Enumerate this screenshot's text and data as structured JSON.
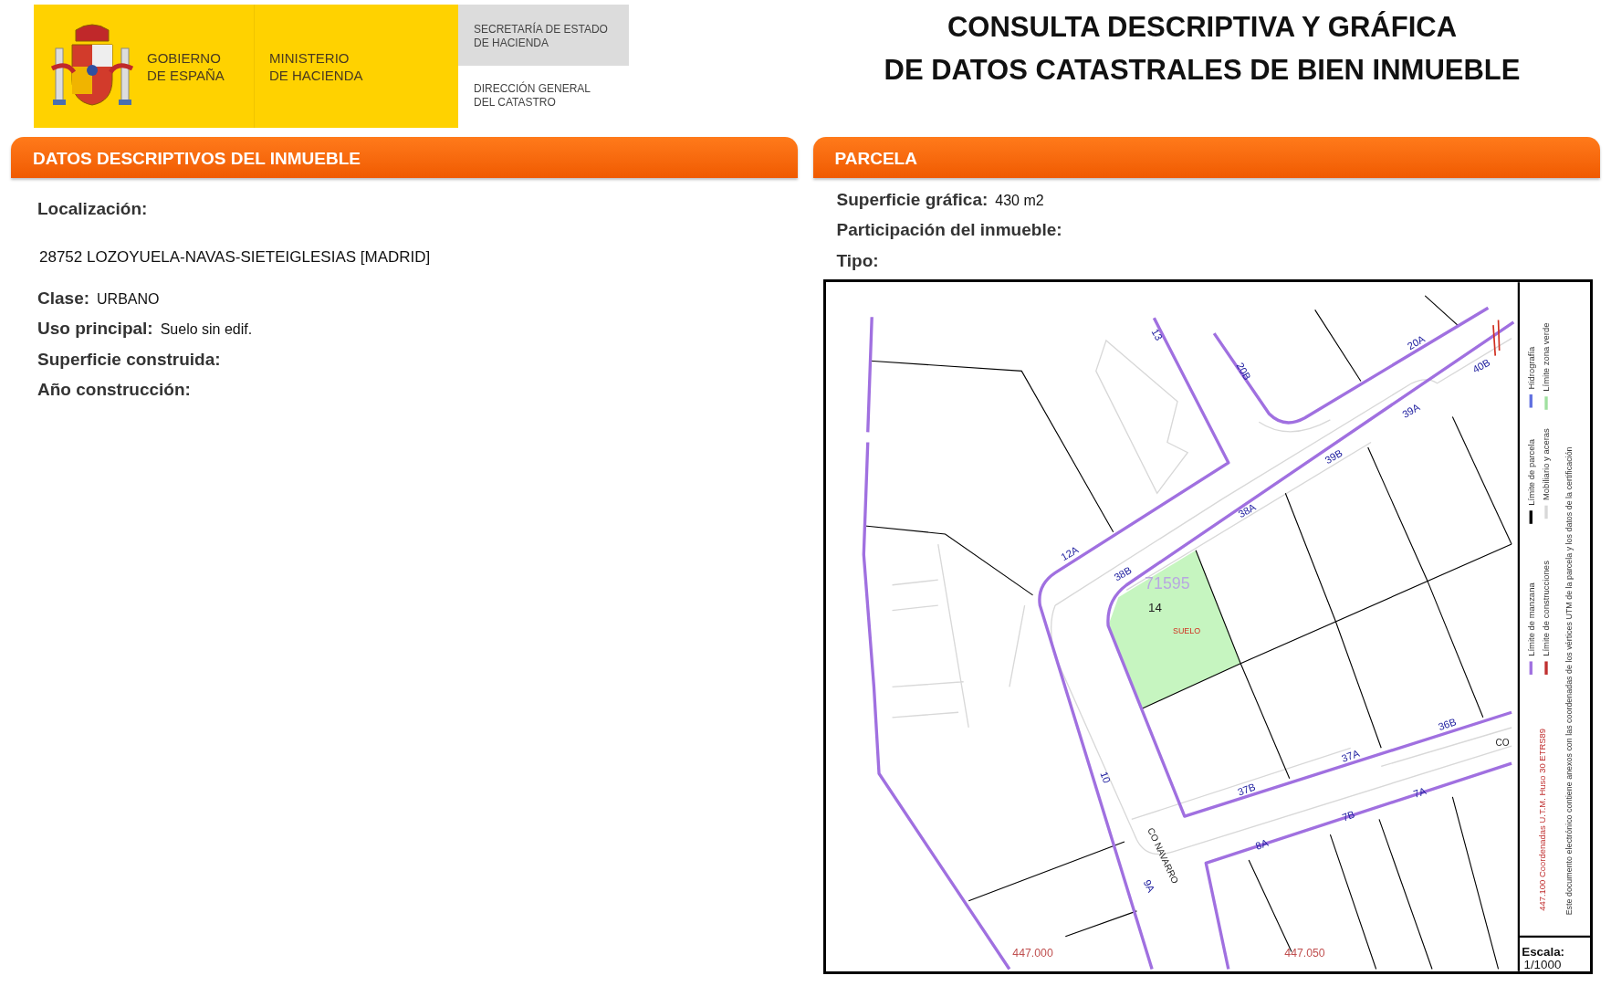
{
  "header": {
    "logo": {
      "government": [
        "GOBIERNO",
        "DE ESPAÑA"
      ],
      "ministry": [
        "MINISTERIO",
        "DE HACIENDA"
      ],
      "secretariat": [
        "SECRETARÍA DE ESTADO",
        "DE HACIENDA"
      ],
      "directorate": [
        "DIRECCIÓN GENERAL",
        "DEL CATASTRO"
      ]
    },
    "title": [
      "CONSULTA DESCRIPTIVA Y GRÁFICA",
      "DE DATOS CATASTRALES DE BIEN INMUEBLE"
    ]
  },
  "descriptive": {
    "title": "DATOS DESCRIPTIVOS DEL INMUEBLE",
    "location_label": "Localización:",
    "address": "28752 LOZOYUELA-NAVAS-SIETEIGLESIAS [MADRID]",
    "fields": [
      {
        "label": "Clase:",
        "value": "URBANO"
      },
      {
        "label": "Uso principal:",
        "value": "Suelo sin edif."
      },
      {
        "label": "Superficie construida:"
      },
      {
        "label": "Año construcción:"
      }
    ]
  },
  "parcel": {
    "title": "PARCELA",
    "fields": [
      {
        "label": "Superficie gráfica:",
        "value": "430 m2"
      },
      {
        "label": "Participación del inmueble:"
      },
      {
        "label": "Tipo:"
      }
    ],
    "map": {
      "labels": [
        {
          "text": "13",
          "kind": "number"
        },
        {
          "text": "20B",
          "kind": "number"
        },
        {
          "text": "20A",
          "kind": "number"
        },
        {
          "text": "40B",
          "kind": "number"
        },
        {
          "text": "39A",
          "kind": "number"
        },
        {
          "text": "39B",
          "kind": "number"
        },
        {
          "text": "38A",
          "kind": "number"
        },
        {
          "text": "12A",
          "kind": "number"
        },
        {
          "text": "71595",
          "kind": "block"
        },
        {
          "text": "38B",
          "kind": "number"
        },
        {
          "text": "14",
          "kind": "parcel"
        },
        {
          "text": "SUELO",
          "kind": "use"
        },
        {
          "text": "36B",
          "kind": "number"
        },
        {
          "text": "CO",
          "kind": "street"
        },
        {
          "text": "37A",
          "kind": "number"
        },
        {
          "text": "37B",
          "kind": "number"
        },
        {
          "text": "10",
          "kind": "number"
        },
        {
          "text": "CO NAVARRO",
          "kind": "street"
        },
        {
          "text": "9A",
          "kind": "number"
        },
        {
          "text": "8A",
          "kind": "number"
        },
        {
          "text": "7B",
          "kind": "number"
        },
        {
          "text": "7A",
          "kind": "number"
        },
        {
          "text": "447.000",
          "kind": "coordinate"
        },
        {
          "text": "447.050",
          "kind": "coordinate"
        }
      ],
      "legend": [
        {
          "label": "Límite de manzana",
          "color": "#a070e0"
        },
        {
          "label": "Límite de parcela",
          "color": "#000000"
        },
        {
          "label": "Hidrografía",
          "color": "#6070e0"
        },
        {
          "label": "Límite de construcciones",
          "color": "#c03030"
        },
        {
          "label": "Mobiliario y aceras",
          "color": "#d8d8d8"
        },
        {
          "label": "Límite zona verde",
          "color": "#a0e0a0"
        }
      ],
      "coordinates_note": "447.100 Coordenadas U.T.M. Huso 30 ETRS89",
      "note": "Este documento electrónico contiene anexos con las coordenadas de los vértices UTM de la parcela y los datos de la certificación",
      "scale_label": "Escala:",
      "scale": "1/1000"
    }
  }
}
